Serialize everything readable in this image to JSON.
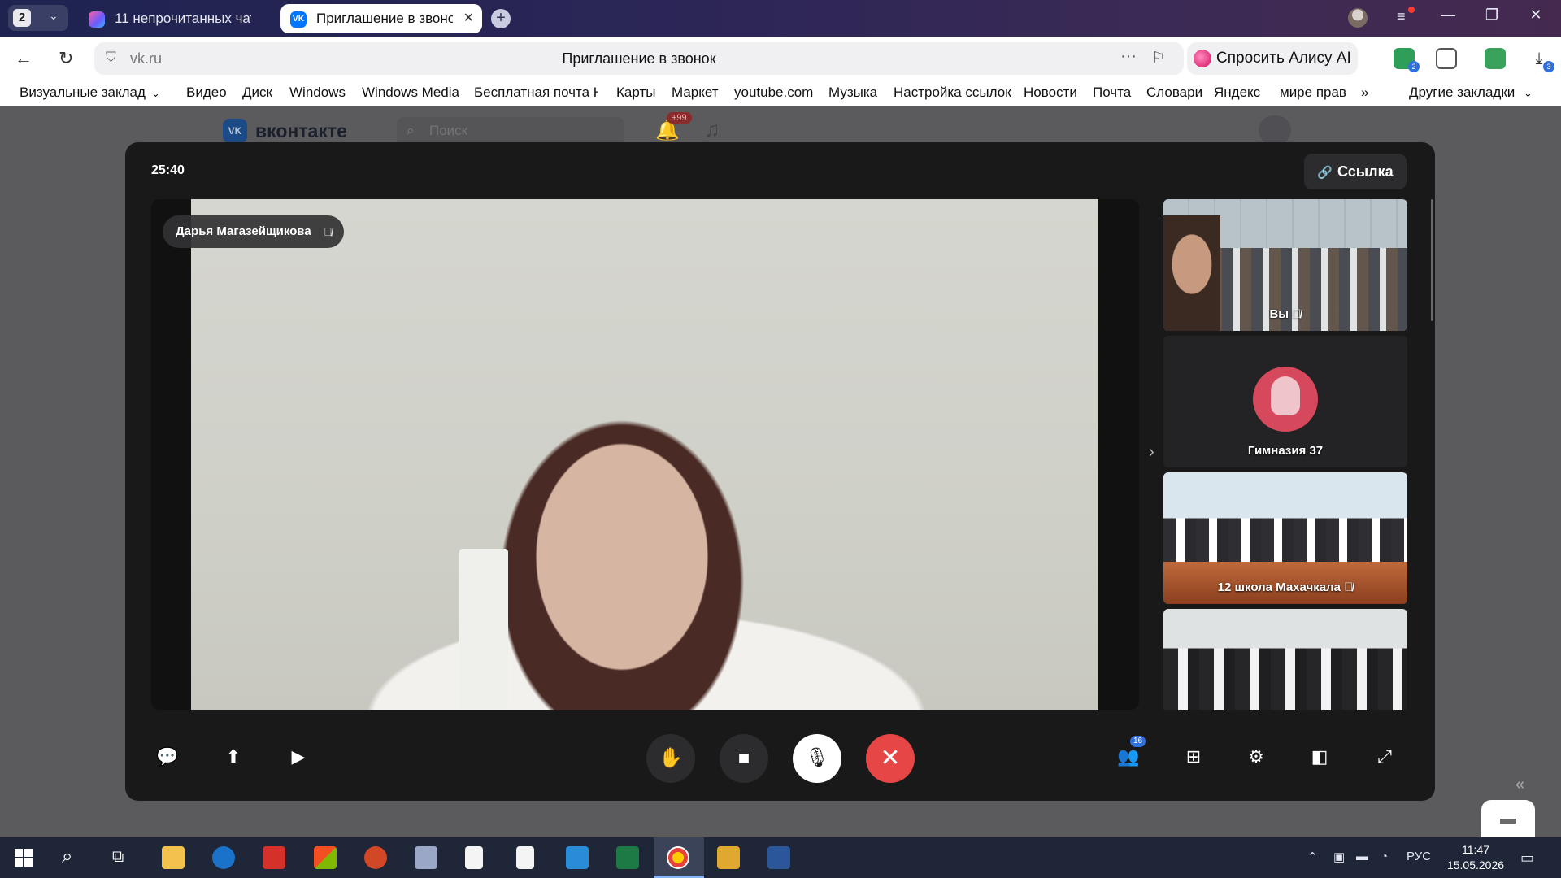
{
  "browser": {
    "tab_counter": "2",
    "tabs": [
      {
        "title": "11 непрочитанных чатов",
        "active": false
      },
      {
        "title": "Приглашение в звонок",
        "active": true
      }
    ],
    "address": {
      "domain": "vk.ru",
      "page_title": "Приглашение в звонок"
    },
    "alice_label": "Спросить Алису AI",
    "extension_badges": {
      "ext1": "2",
      "downloads": "3"
    },
    "bookmarks": [
      "Визуальные заклад",
      "Видео",
      "Диск",
      "Windows",
      "Windows Media",
      "Бесплатная почта Н",
      "Карты",
      "Маркет",
      "youtube.com",
      "Музыка",
      "Настройка ссылок",
      "Новости",
      "Почта",
      "Словари",
      "Яндекс",
      "мире прав"
    ],
    "other_bookmarks": "Другие закладки"
  },
  "vk": {
    "logo": "VK",
    "name": "вконтакте",
    "search_placeholder": "Поиск",
    "notifications": "+99"
  },
  "call": {
    "timer": "25:40",
    "link_label": "Ссылка",
    "main_speaker": "Дарья Магазейщикова",
    "participants": [
      {
        "name": "Вы",
        "muted": true
      },
      {
        "name": "Гимназия 37",
        "muted": false
      },
      {
        "name": "12 школа Махачкала",
        "muted": true
      },
      {
        "name": "",
        "muted": false
      }
    ],
    "participant_count": "16",
    "accent_color": "#e64646"
  },
  "taskbar": {
    "language": "РУС",
    "time": "11:47",
    "date": "15.05.2026"
  }
}
